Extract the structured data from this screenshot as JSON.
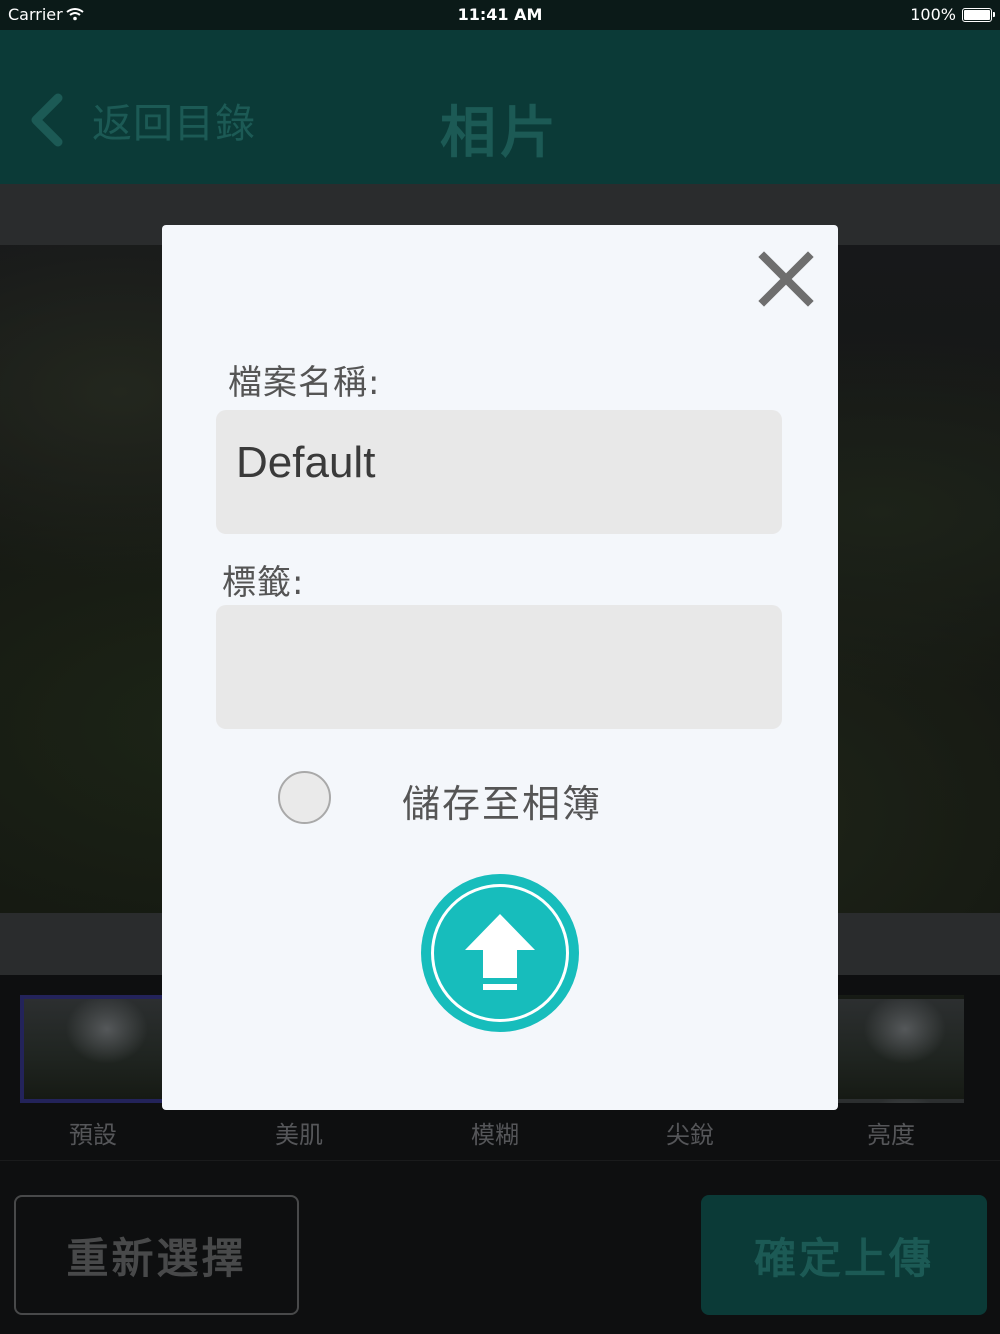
{
  "status_bar": {
    "carrier": "Carrier",
    "time": "11:41 AM",
    "battery": "100%"
  },
  "nav": {
    "back_label": "返回目錄",
    "title": "相片"
  },
  "filters": [
    {
      "label": "預設",
      "selected": true
    },
    {
      "label": "美肌",
      "selected": false
    },
    {
      "label": "模糊",
      "selected": false
    },
    {
      "label": "尖銳",
      "selected": false
    },
    {
      "label": "亮度",
      "selected": false
    }
  ],
  "bottom": {
    "reselect_label": "重新選擇",
    "confirm_label": "確定上傳"
  },
  "modal": {
    "filename_label": "檔案名稱:",
    "filename_value": "Default",
    "tags_label": "標籤:",
    "tags_value": "",
    "save_to_album_label": "儲存至相簿",
    "save_to_album_checked": false
  },
  "colors": {
    "accent": "#17bdbc",
    "nav_bg": "#0b3a37",
    "modal_bg": "#f4f7fb"
  },
  "icons": {
    "close": "close-icon",
    "back": "chevron-left-icon",
    "upload": "upload-arrow-icon"
  }
}
